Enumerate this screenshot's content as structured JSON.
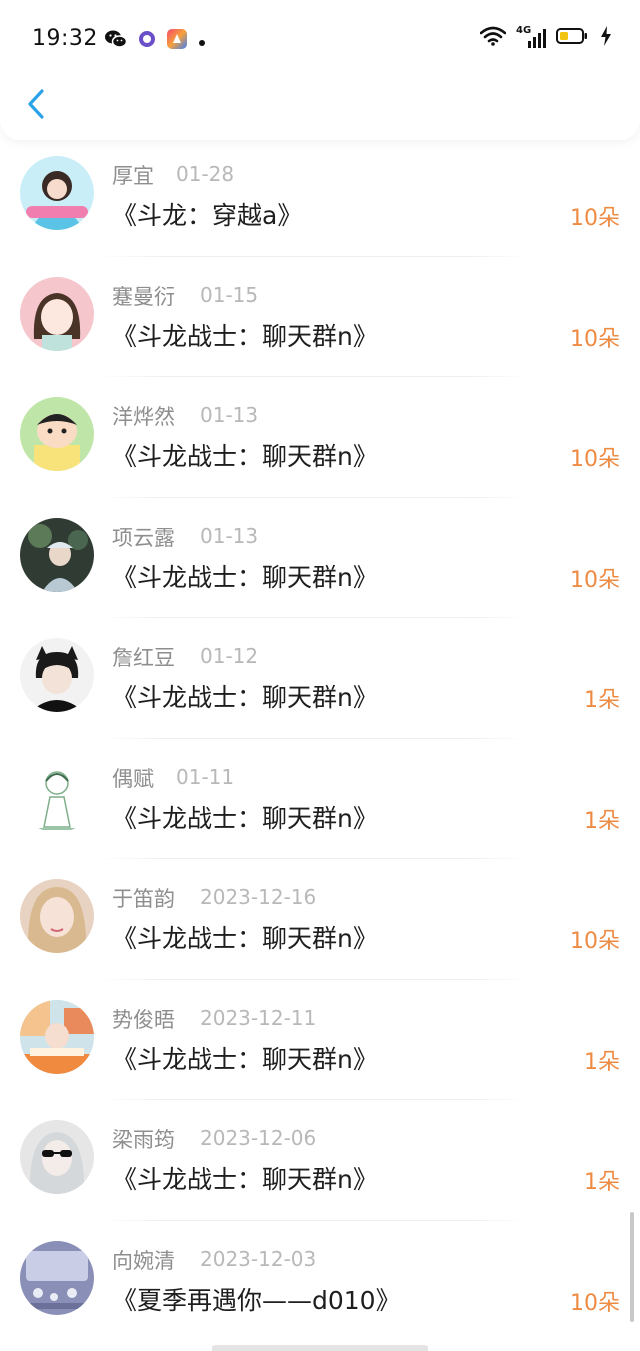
{
  "status_bar": {
    "time": "19:32",
    "network": "4G"
  },
  "nav": {
    "back_icon": "chevron-left-icon"
  },
  "accent_color": "#ee8b43",
  "nav_color": "#2aa3e8",
  "records": [
    {
      "name": "厚宜",
      "date": "01-28",
      "title": "《斗龙：穿越a》",
      "gift": "10朵"
    },
    {
      "name": "蹇曼衍",
      "date": "01-15",
      "title": "《斗龙战士：聊天群n》",
      "gift": "10朵"
    },
    {
      "name": "洋烨然",
      "date": "01-13",
      "title": "《斗龙战士：聊天群n》",
      "gift": "10朵"
    },
    {
      "name": "项云露",
      "date": "01-13",
      "title": "《斗龙战士：聊天群n》",
      "gift": "10朵"
    },
    {
      "name": "詹红豆",
      "date": "01-12",
      "title": "《斗龙战士：聊天群n》",
      "gift": "1朵"
    },
    {
      "name": "偶赋",
      "date": "01-11",
      "title": "《斗龙战士：聊天群n》",
      "gift": "1朵"
    },
    {
      "name": "于笛韵",
      "date": "2023-12-16",
      "title": "《斗龙战士：聊天群n》",
      "gift": "10朵"
    },
    {
      "name": "势俊晤",
      "date": "2023-12-11",
      "title": "《斗龙战士：聊天群n》",
      "gift": "1朵"
    },
    {
      "name": "梁雨筠",
      "date": "2023-12-06",
      "title": "《斗龙战士：聊天群n》",
      "gift": "1朵"
    },
    {
      "name": "向婉清",
      "date": "2023-12-03",
      "title": "《夏季再遇你——d010》",
      "gift": "10朵"
    }
  ]
}
